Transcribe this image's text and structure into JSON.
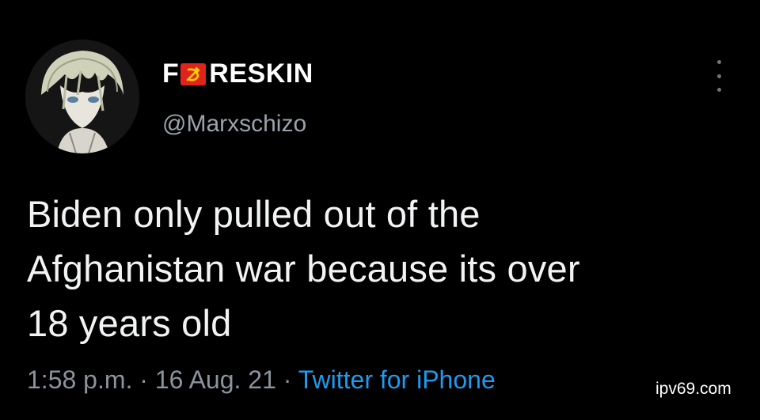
{
  "tweet": {
    "display_name_prefix": "F",
    "display_name_suffix": "RESKIN",
    "display_name_emoji": "hammer-and-sickle-icon",
    "handle": "@Marxschizo",
    "text_lines": [
      "Biden only pulled out of the",
      "Afghanistan war because its over",
      "18 years old"
    ],
    "time": "1:58 p.m.",
    "separator": "·",
    "date": "16 Aug. 21",
    "source": "Twitter for iPhone"
  },
  "watermark": "ipv69.com",
  "colors": {
    "background": "#000000",
    "text": "#f2f3f4",
    "muted": "#8b949c",
    "link": "#1d9bf0",
    "flag_red": "#e0241c",
    "flag_yellow": "#ffd200"
  }
}
